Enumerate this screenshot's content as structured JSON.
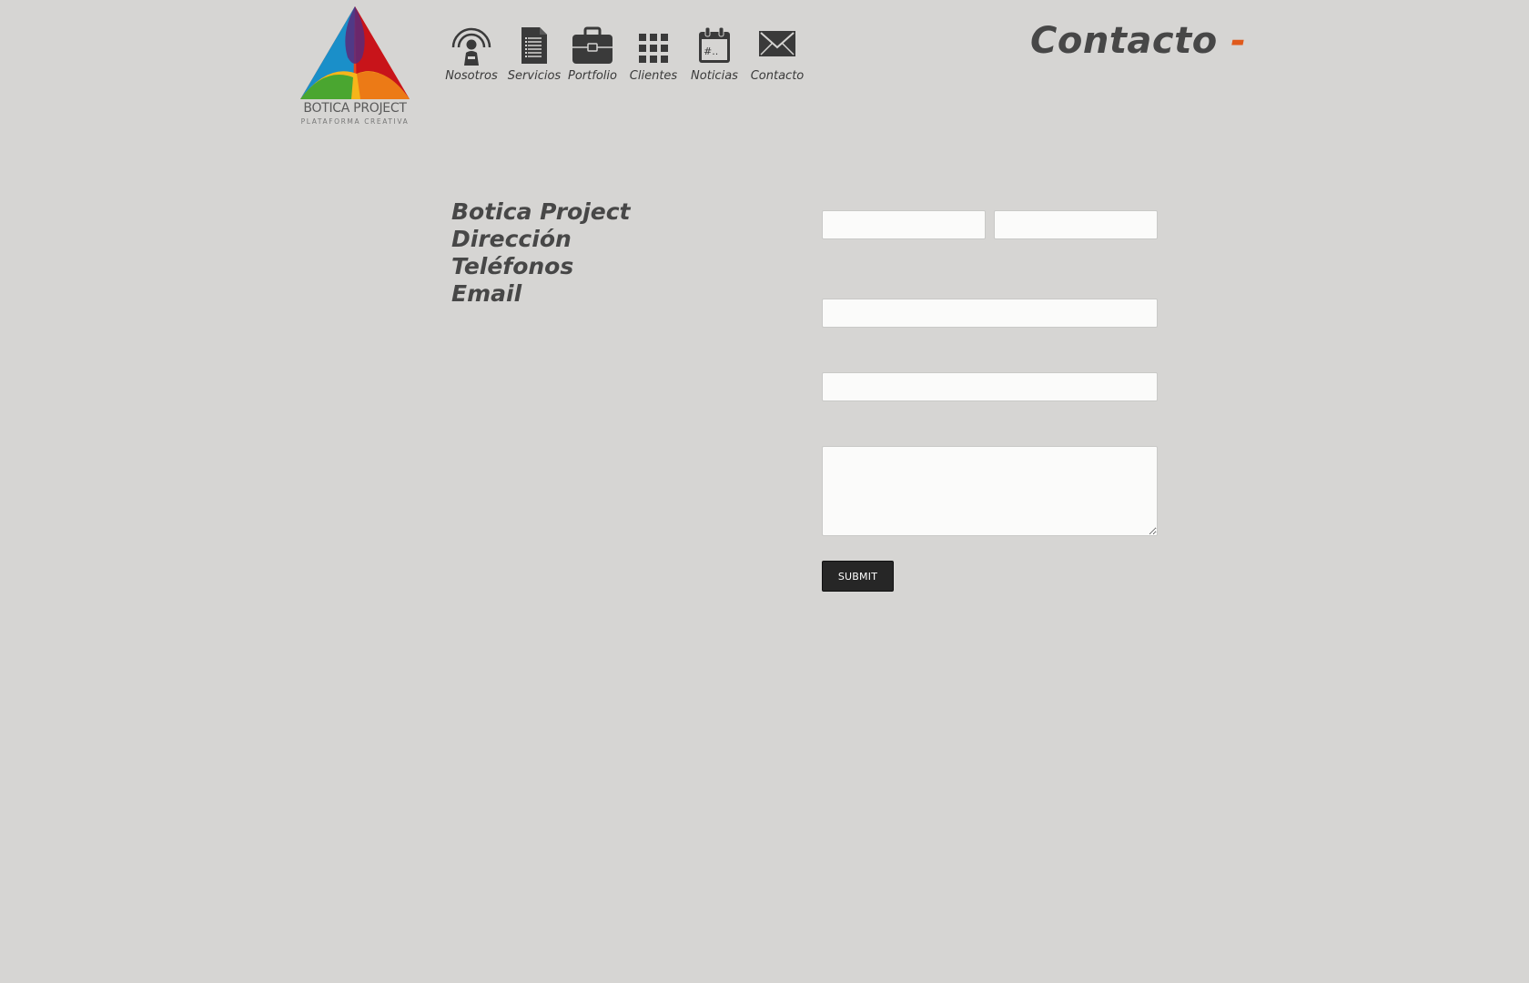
{
  "brand": {
    "logo_icon": "tricolor-triangle-logo",
    "name": "BOTICA PROJECT",
    "tagline": "PLATAFORMA CREATIVA"
  },
  "nav": {
    "items": [
      {
        "label": "Nosotros",
        "icon": "person-broadcast-icon"
      },
      {
        "label": "Servicios",
        "icon": "document-icon"
      },
      {
        "label": "Portfolio",
        "icon": "briefcase-icon"
      },
      {
        "label": "Clientes",
        "icon": "grid-icon"
      },
      {
        "label": "Noticias",
        "icon": "calendar-icon"
      },
      {
        "label": "Contacto",
        "icon": "envelope-icon"
      }
    ]
  },
  "page": {
    "title": "Contacto",
    "title_accent": "-"
  },
  "info": {
    "lines": [
      "Botica Project",
      "Dirección",
      "Teléfonos",
      "Email"
    ]
  },
  "form": {
    "first_name": {
      "value": "",
      "placeholder": ""
    },
    "last_name": {
      "value": "",
      "placeholder": ""
    },
    "email": {
      "value": "",
      "placeholder": ""
    },
    "subject": {
      "value": "",
      "placeholder": ""
    },
    "message": {
      "value": "",
      "placeholder": ""
    },
    "submit_label": "SUBMIT"
  },
  "colors": {
    "background": "#d6d5d3",
    "text": "#474747",
    "accent": "#e05a1c",
    "button": "#262626"
  }
}
